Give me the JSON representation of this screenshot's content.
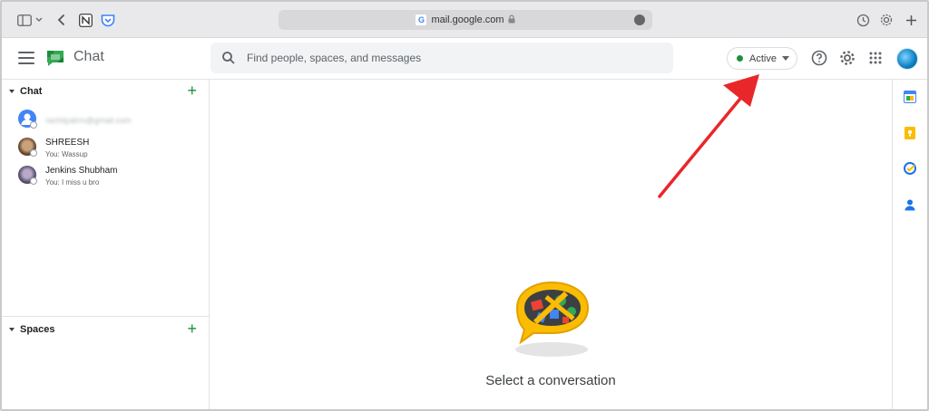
{
  "browser": {
    "url": "mail.google.com",
    "favicon_letter": "G"
  },
  "header": {
    "app_title": "Chat",
    "search_placeholder": "Find people, spaces, and messages",
    "status_label": "Active"
  },
  "sidebar": {
    "chat_section_label": "Chat",
    "spaces_section_label": "Spaces",
    "dms": [
      {
        "name": "rachitpalrm@gmail.com",
        "preview": "",
        "blurred": true
      },
      {
        "name": "SHREESH",
        "preview": "You: Wassup"
      },
      {
        "name": "Jenkins Shubham",
        "preview": "You: I miss u bro"
      }
    ]
  },
  "main": {
    "empty_state_text": "Select a conversation"
  },
  "colors": {
    "active_green": "#1e8e3e",
    "annotation_arrow": "#e8272a"
  },
  "icons": [
    "sidebar-icon",
    "chevron-left-icon",
    "notion-icon",
    "pocket-icon",
    "lock-icon",
    "history-icon",
    "gear-icon",
    "plus-icon",
    "menu-icon",
    "search-icon",
    "help-icon",
    "apps-grid-icon",
    "calendar-icon",
    "keep-icon",
    "tasks-icon",
    "contacts-icon"
  ]
}
